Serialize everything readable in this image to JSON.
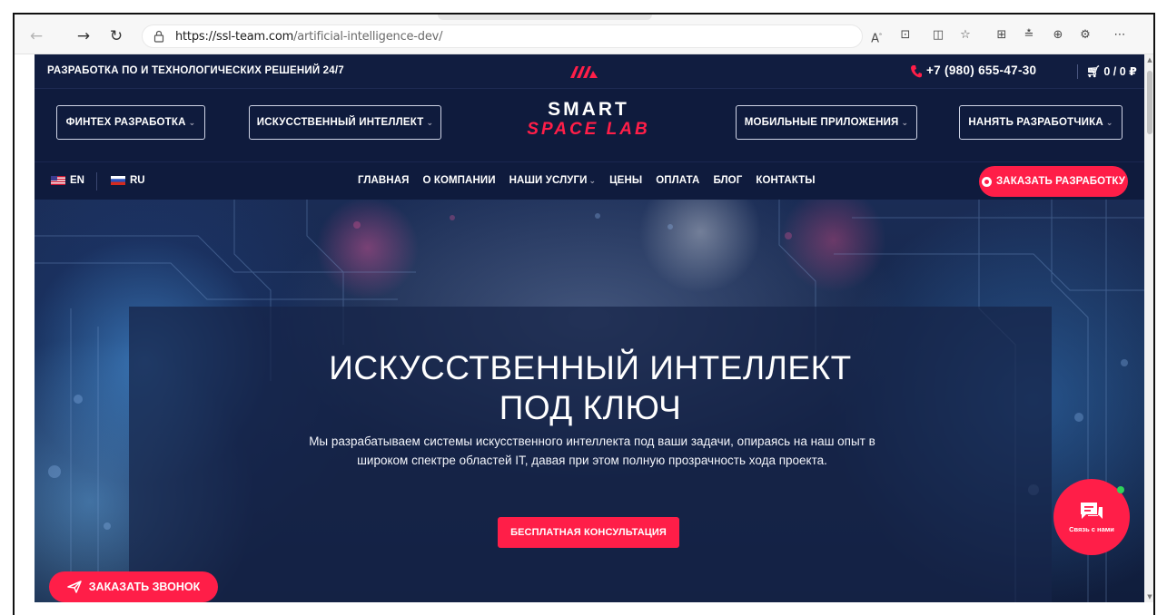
{
  "browser": {
    "url_host": "https://ssl-team.com",
    "url_path": "/artificial-intelligence-dev/",
    "back_icon": "arrow-left-icon",
    "forward_icon": "arrow-right-icon",
    "refresh_icon": "refresh-icon"
  },
  "topbar": {
    "tagline": "РАЗРАБОТКА ПО И ТЕХНОЛОГИЧЕСКИХ РЕШЕНИЙ 24/7",
    "phone": "+7 (980) 655-47-30",
    "cart": "0 / 0 ₽"
  },
  "header": {
    "btn_fintech": "ФИНТЕХ РАЗРАБОТКА",
    "btn_ai": "ИСКУССТВЕННЫЙ ИНТЕЛЛЕКТ",
    "brand_line1": "SMART",
    "brand_line2": "SPACE LAB",
    "btn_mobile": "МОБИЛЬНЫЕ ПРИЛОЖЕНИЯ",
    "btn_hire": "НАНЯТЬ РАЗРАБОТЧИКА"
  },
  "nav": {
    "lang_en": "EN",
    "lang_ru": "RU",
    "items": [
      "ГЛАВНАЯ",
      "О КОМПАНИИ",
      "НАШИ УСЛУГИ",
      "ЦЕНЫ",
      "ОПЛАТА",
      "БЛОГ",
      "КОНТАКТЫ"
    ],
    "order_button": "ЗАКАЗАТЬ РАЗРАБОТКУ"
  },
  "hero": {
    "title_line1": "ИСКУССТВЕННЫЙ ИНТЕЛЛЕКТ",
    "title_line2": "ПОД КЛЮЧ",
    "description": "Мы разрабатываем системы искусственного интеллекта под ваши задачи, опираясь на наш опыт в широком спектре областей IT, давая при этом полную прозрачность хода проекта.",
    "cta": "БЕСПЛАТНАЯ КОНСУЛЬТАЦИЯ"
  },
  "floating": {
    "callback": "ЗАКАЗАТЬ ЗВОНОК",
    "chat_label": "Связь с нами"
  },
  "colors": {
    "accent": "#ff1e48",
    "navy": "#0f1b3d"
  }
}
